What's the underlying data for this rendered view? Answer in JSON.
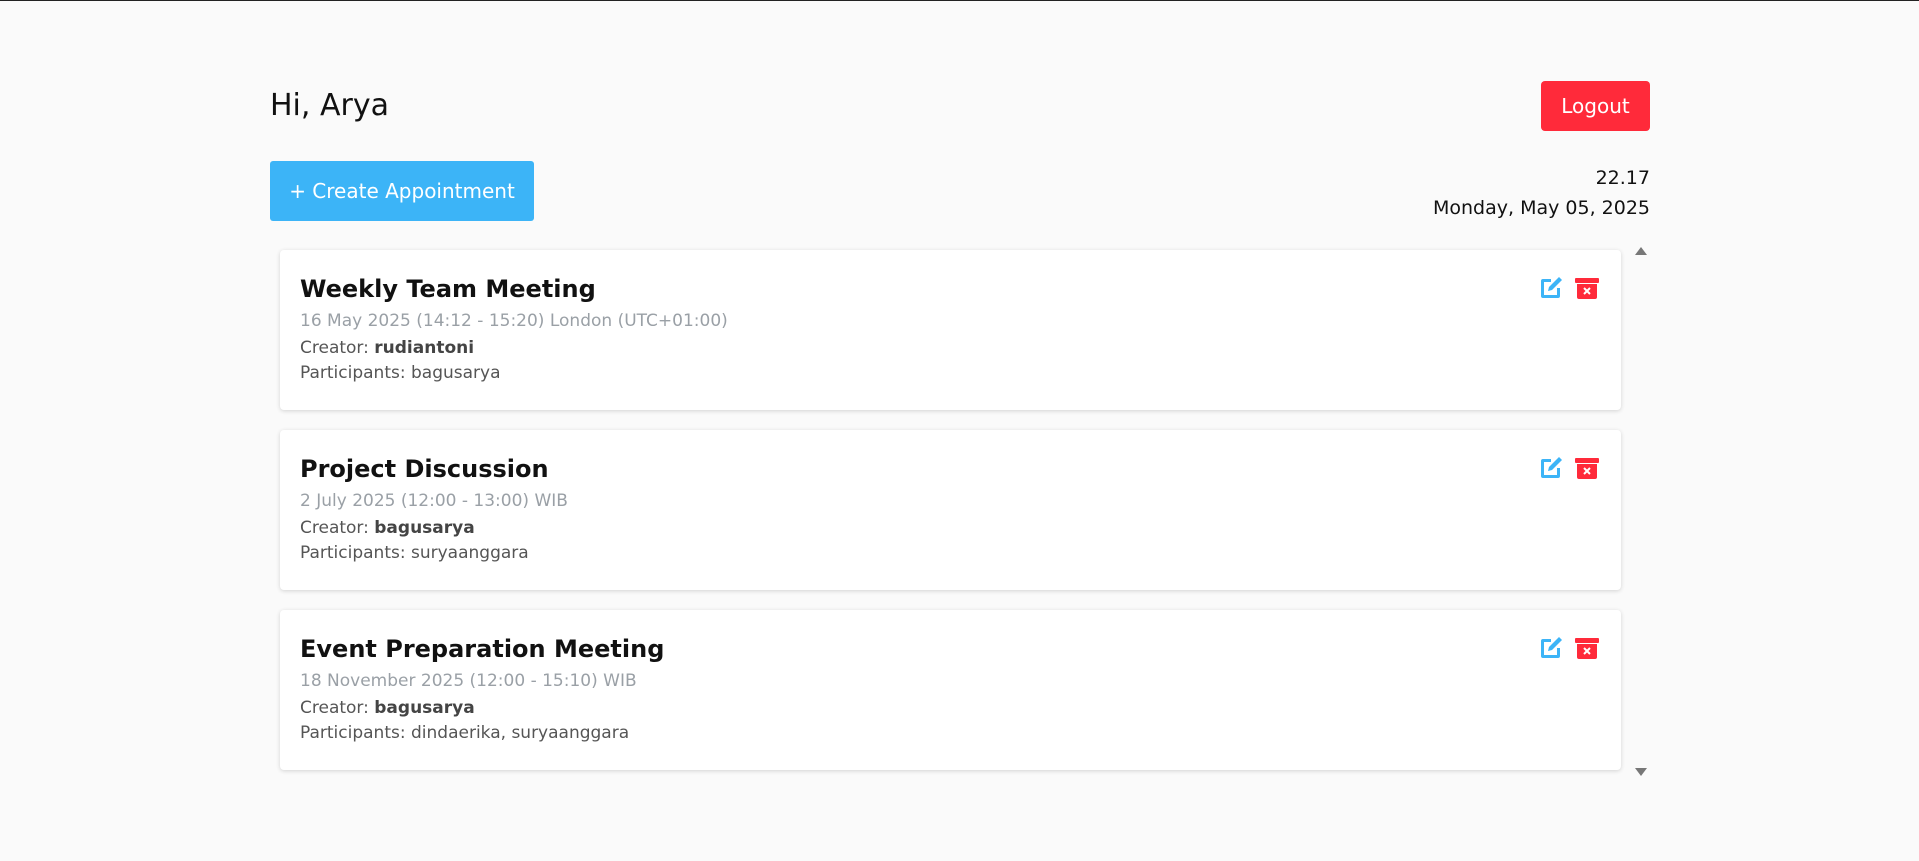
{
  "header": {
    "greeting": "Hi, Arya",
    "logout_label": "Logout"
  },
  "toolbar": {
    "create_label": "+ Create Appointment"
  },
  "clock": {
    "time": "22.17",
    "date": "Monday, May 05, 2025"
  },
  "labels": {
    "creator": "Creator: ",
    "participants": "Participants: "
  },
  "appointments": [
    {
      "title": "Weekly Team Meeting",
      "time": "16 May 2025 (14:12 - 15:20) London (UTC+01:00)",
      "creator": "rudiantoni",
      "participants": "bagusarya"
    },
    {
      "title": "Project Discussion",
      "time": "2 July 2025 (12:00 - 13:00) WIB",
      "creator": "bagusarya",
      "participants": "suryaanggara"
    },
    {
      "title": "Event Preparation Meeting",
      "time": "18 November 2025 (12:00 - 15:10) WIB",
      "creator": "bagusarya",
      "participants": "dindaerika, suryaanggara"
    }
  ],
  "icons": {
    "edit": "edit-icon",
    "delete": "delete-icon",
    "scroll_up": "scroll-up-arrow",
    "scroll_down": "scroll-down-arrow"
  },
  "colors": {
    "logout": "#ff2a3a",
    "create": "#3cb4f7",
    "edit_icon": "#3cb4f7",
    "delete_icon": "#ff2a3a"
  }
}
